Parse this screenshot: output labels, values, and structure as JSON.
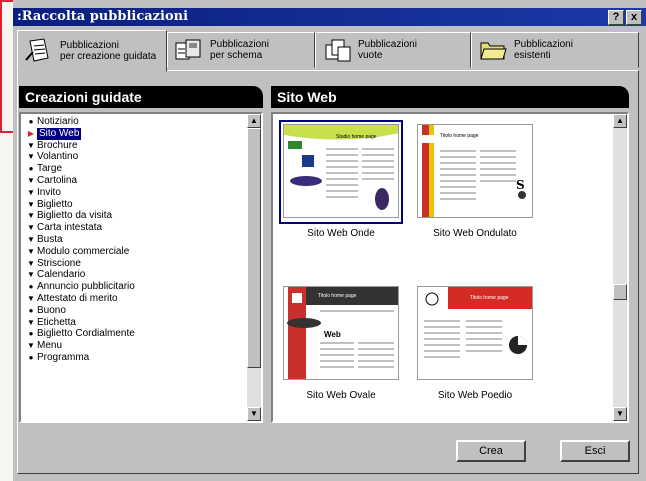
{
  "window": {
    "title": ":Raccolta pubblicazioni",
    "help_label": "?",
    "close_label": "x"
  },
  "tabs": [
    {
      "line1": "Pubblicazioni",
      "line2": "per creazione guidata"
    },
    {
      "line1": "Pubblicazioni",
      "line2": "per schema"
    },
    {
      "line1": "Pubblicazioni",
      "line2": "vuote"
    },
    {
      "line1": "Pubblicazioni",
      "line2": "esistenti"
    }
  ],
  "left_panel": {
    "header": "Creazioni guidate",
    "items": [
      {
        "label": "Notiziario",
        "bullet": "●"
      },
      {
        "label": "Sito Web",
        "bullet": "▶",
        "selected": true
      },
      {
        "label": "Brochure",
        "bullet": "▼"
      },
      {
        "label": "Volantino",
        "bullet": "▼"
      },
      {
        "label": "Targe",
        "bullet": "●"
      },
      {
        "label": "Cartolina",
        "bullet": "▼"
      },
      {
        "label": "Invito",
        "bullet": "▼"
      },
      {
        "label": "Biglietto",
        "bullet": "▼"
      },
      {
        "label": "Biglietto da visita",
        "bullet": "▼"
      },
      {
        "label": "Carta intestata",
        "bullet": "▼"
      },
      {
        "label": "Busta",
        "bullet": "▼"
      },
      {
        "label": "Modulo commerciale",
        "bullet": "▼"
      },
      {
        "label": "Striscione",
        "bullet": "▼"
      },
      {
        "label": "Calendario",
        "bullet": "▼"
      },
      {
        "label": "Annuncio pubblicitario",
        "bullet": "●"
      },
      {
        "label": "Attestato di merito",
        "bullet": "▼"
      },
      {
        "label": "Buono",
        "bullet": "●"
      },
      {
        "label": "Etichetta",
        "bullet": "▼"
      },
      {
        "label": "Biglietto Cordialmente",
        "bullet": "●"
      },
      {
        "label": "Menu",
        "bullet": "▼"
      },
      {
        "label": "Programma",
        "bullet": "●"
      }
    ]
  },
  "right_panel": {
    "header": "Sito Web",
    "thumbnails": [
      {
        "caption": "Sito Web Onde",
        "page_heading": "Studio home page",
        "selected": true
      },
      {
        "caption": "Sito Web Ondulato",
        "page_heading": "Titolo home page"
      },
      {
        "caption": "Sito Web Ovale",
        "page_heading": "Titolo home page"
      },
      {
        "caption": "Sito Web Poedio",
        "page_heading": "Titolo home page"
      }
    ]
  },
  "buttons": {
    "create": "Crea",
    "exit": "Esci"
  },
  "colors": {
    "title_bar": "#0a1f7e",
    "selection": "#000080",
    "accent_red": "#dd2222"
  }
}
